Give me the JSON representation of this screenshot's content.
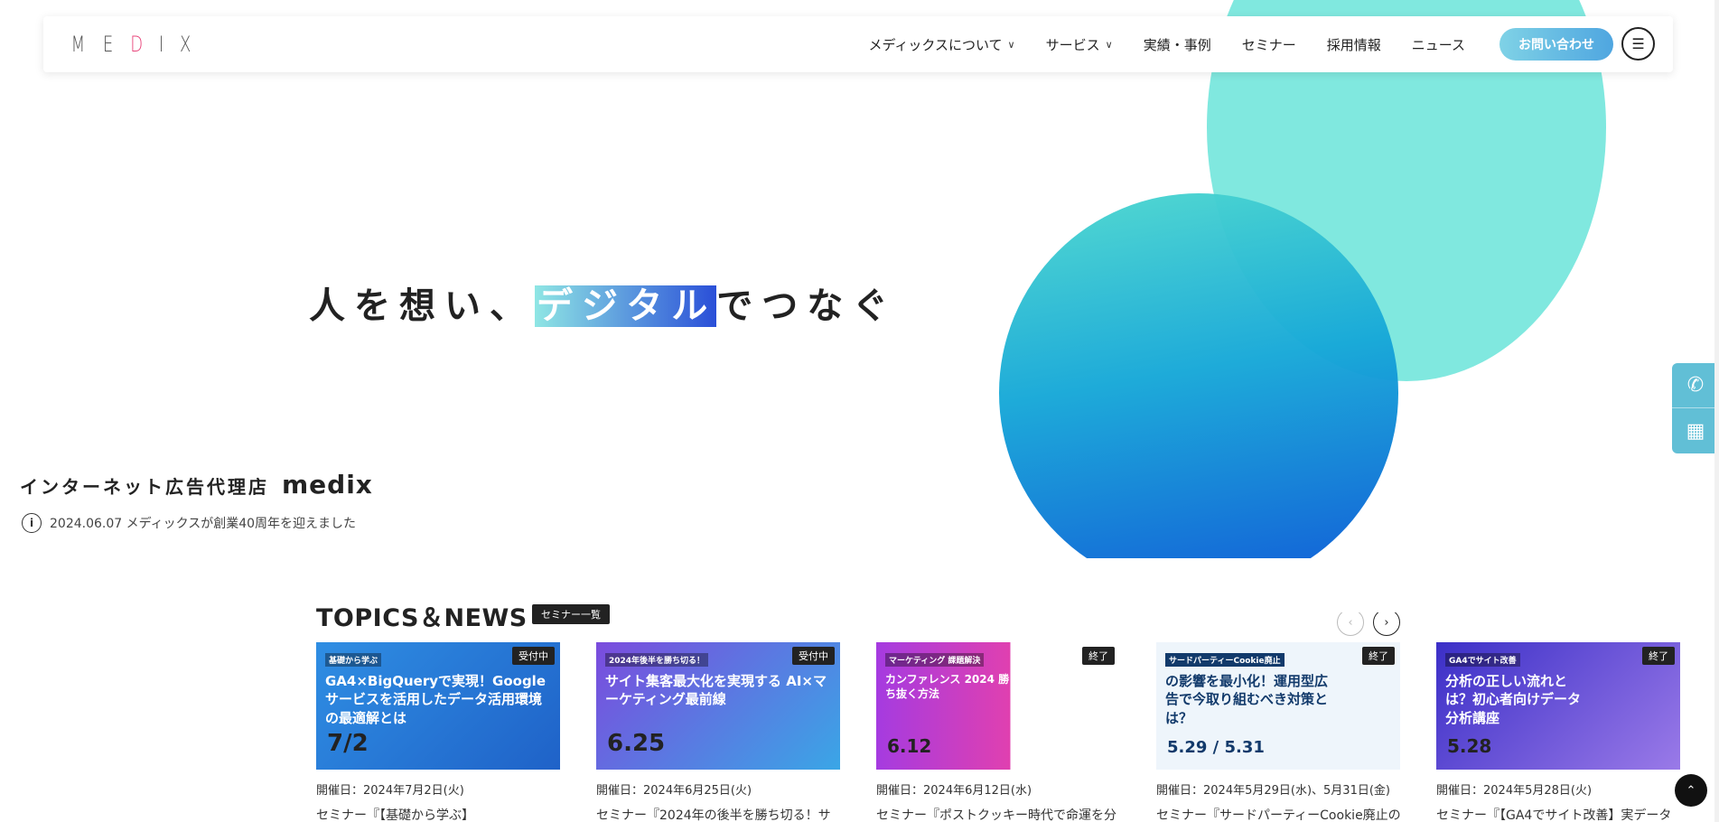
{
  "header": {
    "logo_letters": [
      "M",
      "E",
      "D",
      "I",
      "X"
    ],
    "nav": [
      {
        "label": "メディックスについて",
        "has_dropdown": true
      },
      {
        "label": "サービス",
        "has_dropdown": true
      },
      {
        "label": "実績・事例",
        "has_dropdown": false
      },
      {
        "label": "セミナー",
        "has_dropdown": false
      },
      {
        "label": "採用情報",
        "has_dropdown": false
      },
      {
        "label": "ニュース",
        "has_dropdown": false
      }
    ],
    "contact_label": "お問い合わせ",
    "menu_icon": "hamburger-icon"
  },
  "hero": {
    "tagline_pre": "人を想い、",
    "tagline_highlight": "デジタル",
    "tagline_post": "でつなぐ",
    "agency_jp": "インターネット広告代理店",
    "agency_en": "medix",
    "notice": "2024.06.07 メディックスが創業40周年を迎えました"
  },
  "side_tabs": [
    {
      "icon": "phone-icon"
    },
    {
      "icon": "calendar-icon"
    }
  ],
  "topics": {
    "title": "TOPICS＆NEWS",
    "seminar_list_label": "セミナー一覧",
    "cards": [
      {
        "badge": "受付中",
        "thumb_small": "基礎から学ぶ",
        "thumb_text": "GA4×BigQueryで実現！Googleサービスを活用したデータ活用環境の最適解とは",
        "thumb_date": "7/2",
        "date": "開催日：2024年7月2日(火)",
        "title": "セミナー『【基礎から学ぶ】"
      },
      {
        "badge": "受付中",
        "thumb_small": "2024年後半を勝ち切る！",
        "thumb_text": "サイト集客最大化を実現する AI×マーケティング最前線",
        "thumb_date": "6.25",
        "date": "開催日：2024年6月25日(火)",
        "title": "セミナー『2024年の後半を勝ち切る！サ"
      },
      {
        "badge": "終了",
        "thumb_small": "マーケティング 課題解決",
        "thumb_text": "カンファレンス 2024 勝ち抜く方法",
        "thumb_date": "6.12",
        "date": "開催日：2024年6月12日(水)",
        "title": "セミナー『ポストクッキー時代で命運を分"
      },
      {
        "badge": "終了",
        "thumb_small": "サードパーティーCookie廃止",
        "thumb_text": "の影響を最小化！運用型広告で今取り組むべき対策とは？",
        "thumb_date": "5.29 / 5.31",
        "date": "開催日：2024年5月29日(水)、5月31日(金)",
        "title": "セミナー『サードパーティーCookie廃止の"
      },
      {
        "badge": "終了",
        "thumb_small": "GA4でサイト改善",
        "thumb_text": "分析の正しい流れとは？初心者向けデータ分析講座",
        "thumb_date": "5.28",
        "date": "開催日：2024年5月28日(火)",
        "title": "セミナー『【GA4でサイト改善】実データ"
      }
    ]
  }
}
